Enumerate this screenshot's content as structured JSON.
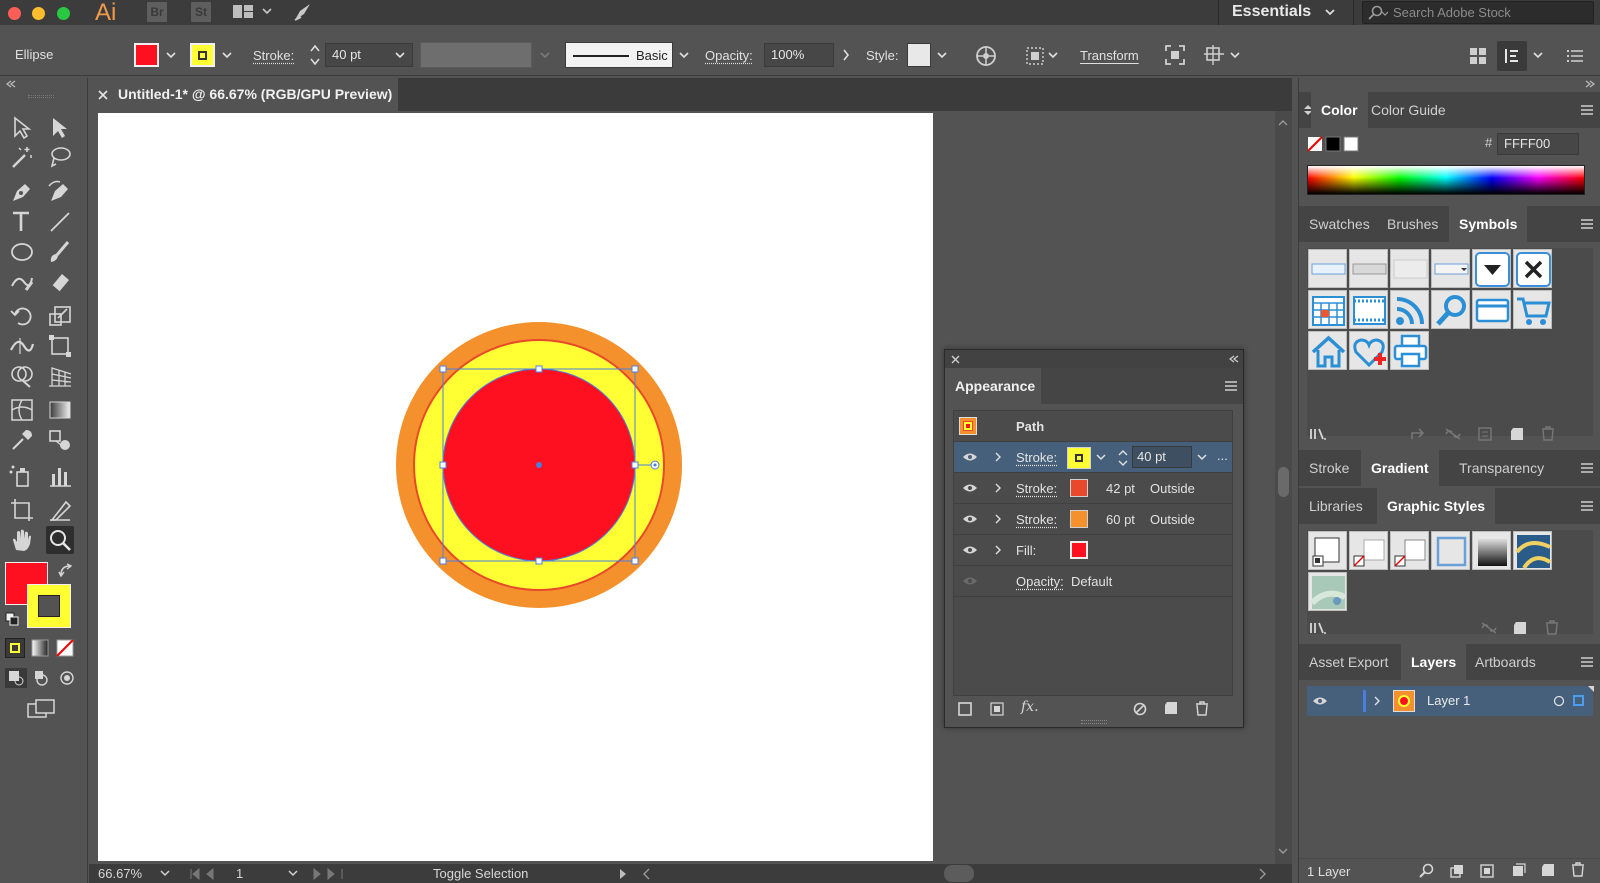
{
  "app": {
    "logo": "Ai",
    "icons": [
      "Br",
      "St"
    ],
    "workspace": "Essentials",
    "stock_search_placeholder": "Search Adobe Stock"
  },
  "control_bar": {
    "object_type": "Ellipse",
    "stroke_label": "Stroke:",
    "stroke_weight": "40 pt",
    "brush_label": "Basic",
    "opacity_label": "Opacity:",
    "opacity_value": "100%",
    "style_label": "Style:",
    "transform_label": "Transform"
  },
  "document": {
    "tab_title": "Untitled-1* @ 66.67% (RGB/GPU Preview)"
  },
  "status_bar": {
    "zoom": "66.67%",
    "artboard_number": "1",
    "status_text": "Toggle Selection"
  },
  "appearance_panel": {
    "title": "Appearance",
    "object_label": "Path",
    "rows": [
      {
        "label": "Stroke:",
        "value": "40 pt",
        "swatch_color": "#FFFF33",
        "selected": true
      },
      {
        "label": "Stroke:",
        "value": "42 pt",
        "position": "Outside",
        "swatch_color": "#E8492A"
      },
      {
        "label": "Stroke:",
        "value": "60 pt",
        "position": "Outside",
        "swatch_color": "#F5912C"
      },
      {
        "label": "Fill:",
        "swatch_color": "#FF1020"
      },
      {
        "label": "Opacity:",
        "value": "Default"
      }
    ],
    "more": "..."
  },
  "color_panel": {
    "tabs": [
      "Color",
      "Color Guide"
    ],
    "active": "Color",
    "hex_label": "#",
    "hex_value": "FFFF00"
  },
  "swatches_panel": {
    "tabs": [
      "Swatches",
      "Brushes",
      "Symbols"
    ],
    "active": "Symbols"
  },
  "gradient_panel": {
    "tabs": [
      "Stroke",
      "Gradient",
      "Transparency"
    ],
    "active": "Gradient"
  },
  "graphic_styles_panel": {
    "tabs": [
      "Libraries",
      "Graphic Styles"
    ],
    "active": "Graphic Styles"
  },
  "layers_panel": {
    "tabs": [
      "Asset Export",
      "Layers",
      "Artboards"
    ],
    "active": "Layers",
    "layers": [
      {
        "name": "Layer 1"
      }
    ],
    "footer_count": "1 Layer"
  },
  "colors": {
    "fill": "#FF1020",
    "stroke_inner": "#FFFF33",
    "stroke_mid": "#E8492A",
    "stroke_outer": "#F5912C",
    "selection": "#4a7fe0"
  }
}
